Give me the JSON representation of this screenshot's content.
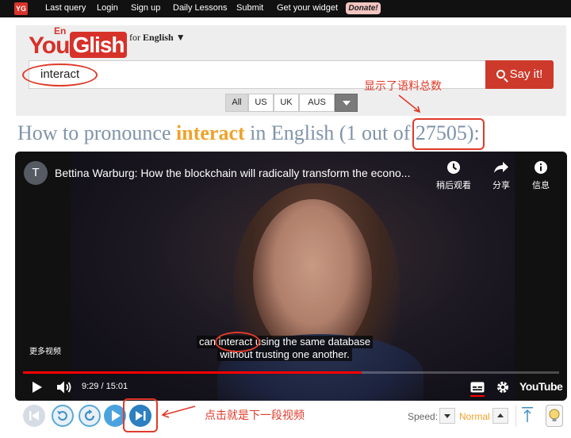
{
  "nav": {
    "logo": "YG",
    "links": [
      "Last query",
      "Login",
      "Sign up",
      "Daily Lessons",
      "Submit",
      "Get your widget"
    ],
    "donate": "Donate!"
  },
  "brand": {
    "logo_you": "You",
    "logo_en": "En",
    "logo_glish": "Glish",
    "for_prefix": "for",
    "language": "English",
    "language_caret": "▼"
  },
  "search": {
    "value": "interact",
    "button_label": "Say it!",
    "accents": [
      "All",
      "US",
      "UK",
      "AUS"
    ],
    "active_accent": "All"
  },
  "heading": {
    "prefix": "How to pronounce",
    "word": "interact",
    "middle": "in English (1 out of",
    "total": "27505",
    "suffix": "):"
  },
  "video": {
    "channel_initial": "T",
    "title": "Bettina Warburg: How the blockchain will radically transform the econo...",
    "actions": [
      {
        "label": "稍后观看",
        "icon": "clock-icon"
      },
      {
        "label": "分享",
        "icon": "share-icon"
      },
      {
        "label": "信息",
        "icon": "info-icon"
      }
    ],
    "more_videos": "更多视频",
    "caption_before": "can",
    "caption_word": "interact",
    "caption_after": "using the same database",
    "caption_line2": "without trusting one another.",
    "time": "9:29 / 15:01",
    "progress": 0.632,
    "brand": "YouTube"
  },
  "controls": {
    "speed_label": "Speed:",
    "speed_value": "Normal"
  },
  "annotations": {
    "corpus_note": "显示了语料总数",
    "next_note": "点击就是下一段视频"
  },
  "colors": {
    "accent_red": "#cd3a2b",
    "heading": "#7f93a8",
    "highlight": "#f0a22a",
    "annotation": "#e03a2a"
  }
}
